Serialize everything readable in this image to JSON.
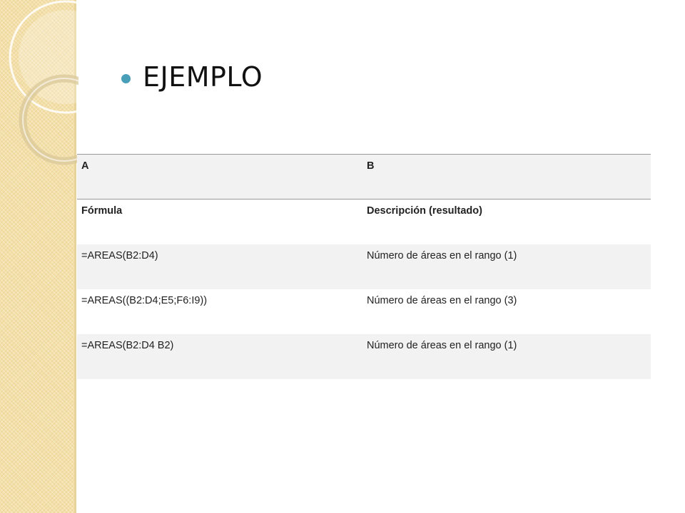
{
  "slide": {
    "title": "EJEMPLO",
    "colors": {
      "bullet": "#4a9fb8",
      "side_band": "#f3dfa8",
      "row_shade": "#f2f2f2"
    }
  },
  "table": {
    "header": [
      "A",
      "B"
    ],
    "subheader": [
      "Fórmula",
      "Descripción (resultado)"
    ],
    "rows": [
      [
        "=AREAS(B2:D4)",
        "Número de áreas en el rango (1)"
      ],
      [
        "=AREAS((B2:D4;E5;F6:I9))",
        "Número de áreas en el rango (3)"
      ],
      [
        "=AREAS(B2:D4 B2)",
        "Número de áreas en el rango (1)"
      ]
    ]
  }
}
